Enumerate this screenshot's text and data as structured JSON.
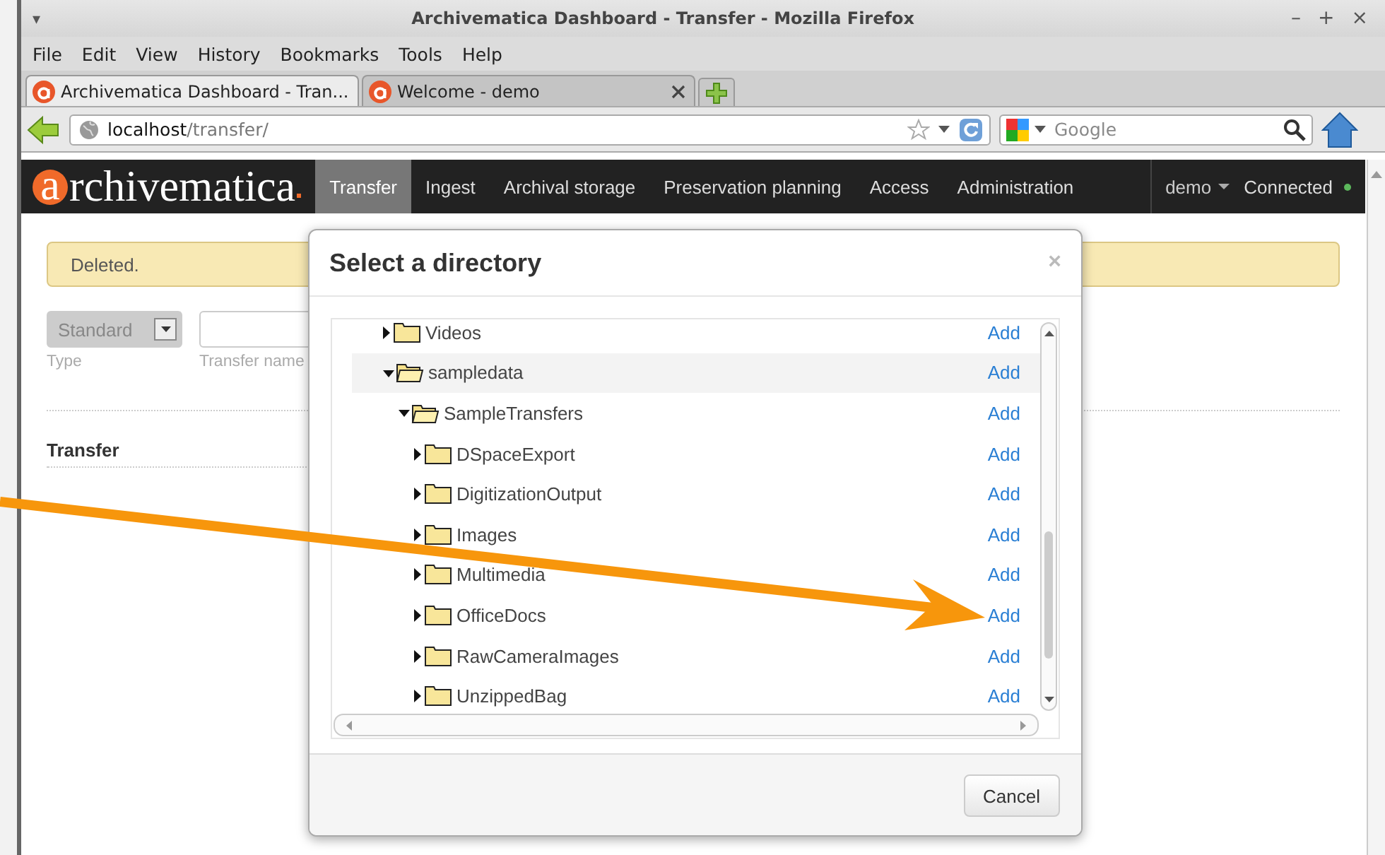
{
  "window": {
    "menu_glyph": "▾",
    "title": "Archivematica Dashboard - Transfer - Mozilla Firefox",
    "controls": [
      "–",
      "+",
      "×"
    ]
  },
  "menu": [
    "File",
    "Edit",
    "View",
    "History",
    "Bookmarks",
    "Tools",
    "Help"
  ],
  "tabs": [
    {
      "label": "Archivematica Dashboard - Tran...",
      "selected": true
    },
    {
      "label": "Welcome - demo",
      "selected": false
    }
  ],
  "address": {
    "url": "**localhost**/transfer/"
  },
  "search": {
    "placeholder": "Google"
  },
  "app": {
    "logo_mark": "a",
    "logo_text": "rchivematica",
    "nav": [
      {
        "label": "Transfer",
        "selected": true
      },
      {
        "label": "Ingest",
        "selected": false
      },
      {
        "label": "Archival storage",
        "selected": false
      },
      {
        "label": "Preservation planning",
        "selected": false
      },
      {
        "label": "Access",
        "selected": false
      },
      {
        "label": "Administration",
        "selected": false
      }
    ],
    "user": "demo",
    "status": {
      "label": "Connected",
      "color": "#5cb85c"
    }
  },
  "notice": "Deleted.",
  "form": {
    "type_value": "Standard",
    "type_label": "Type",
    "name_label": "Transfer name"
  },
  "section_heading": "Transfer",
  "dialog": {
    "title": "Select a directory",
    "close": "×",
    "tree": [
      {
        "name": "Videos",
        "expanded": false,
        "selected": false,
        "action": "Add"
      },
      {
        "name": "sampledata",
        "expanded": true,
        "selected": true,
        "action": "Add",
        "children": [
          {
            "name": "SampleTransfers",
            "expanded": true,
            "selected": false,
            "action": "Add",
            "children": [
              {
                "name": "DSpaceExport",
                "expanded": false,
                "selected": false,
                "action": "Add"
              },
              {
                "name": "DigitizationOutput",
                "expanded": false,
                "selected": false,
                "action": "Add"
              },
              {
                "name": "Images",
                "expanded": false,
                "selected": false,
                "action": "Add"
              },
              {
                "name": "Multimedia",
                "expanded": false,
                "selected": false,
                "action": "Add"
              },
              {
                "name": "OfficeDocs",
                "expanded": false,
                "selected": false,
                "action": "Add"
              },
              {
                "name": "RawCameraImages",
                "expanded": false,
                "selected": false,
                "action": "Add"
              },
              {
                "name": "UnzippedBag",
                "expanded": false,
                "selected": false,
                "action": "Add"
              }
            ]
          }
        ]
      }
    ],
    "cancel": "Cancel"
  }
}
